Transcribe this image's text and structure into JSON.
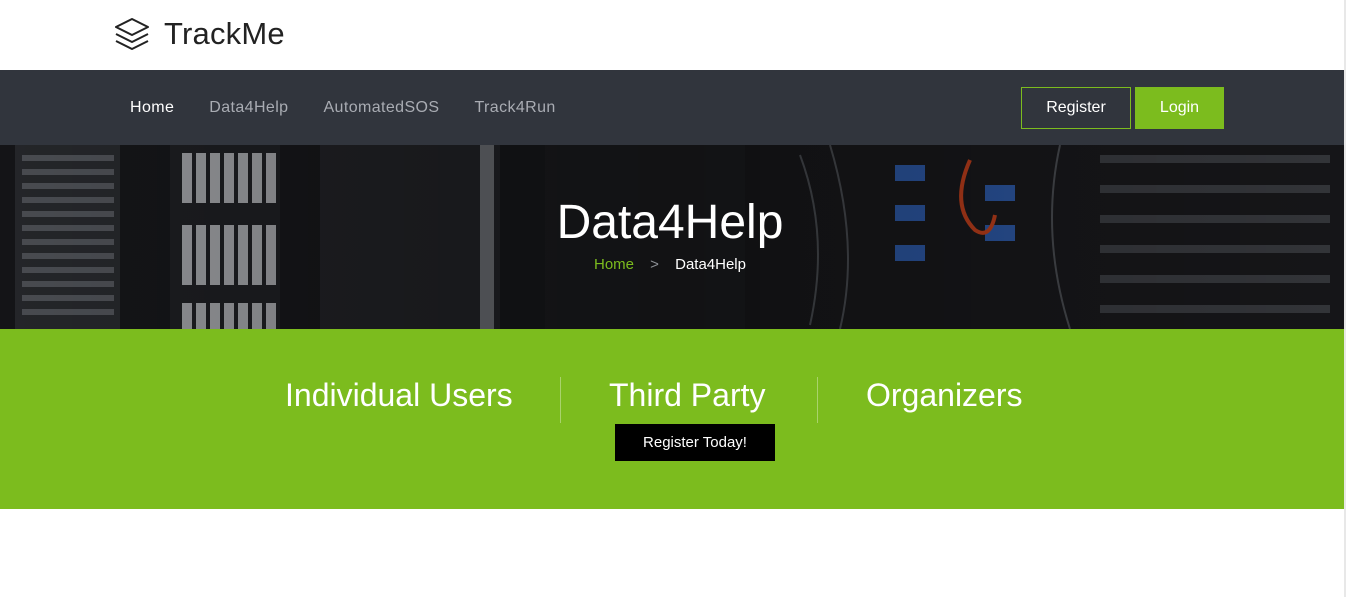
{
  "brand": {
    "name": "TrackMe",
    "icon": "layers-icon"
  },
  "nav": {
    "links": [
      {
        "label": "Home",
        "active": true
      },
      {
        "label": "Data4Help",
        "active": false
      },
      {
        "label": "AutomatedSOS",
        "active": false
      },
      {
        "label": "Track4Run",
        "active": false
      }
    ],
    "register_label": "Register",
    "login_label": "Login"
  },
  "hero": {
    "title": "Data4Help",
    "breadcrumb": {
      "home": "Home",
      "separator": ">",
      "current": "Data4Help"
    }
  },
  "cta": {
    "categories": [
      "Individual Users",
      "Third Party",
      "Organizers"
    ],
    "button_label": "Register Today!"
  },
  "colors": {
    "accent": "#7cbc1e",
    "navbar": "#31353d",
    "cta_button": "#000000"
  }
}
